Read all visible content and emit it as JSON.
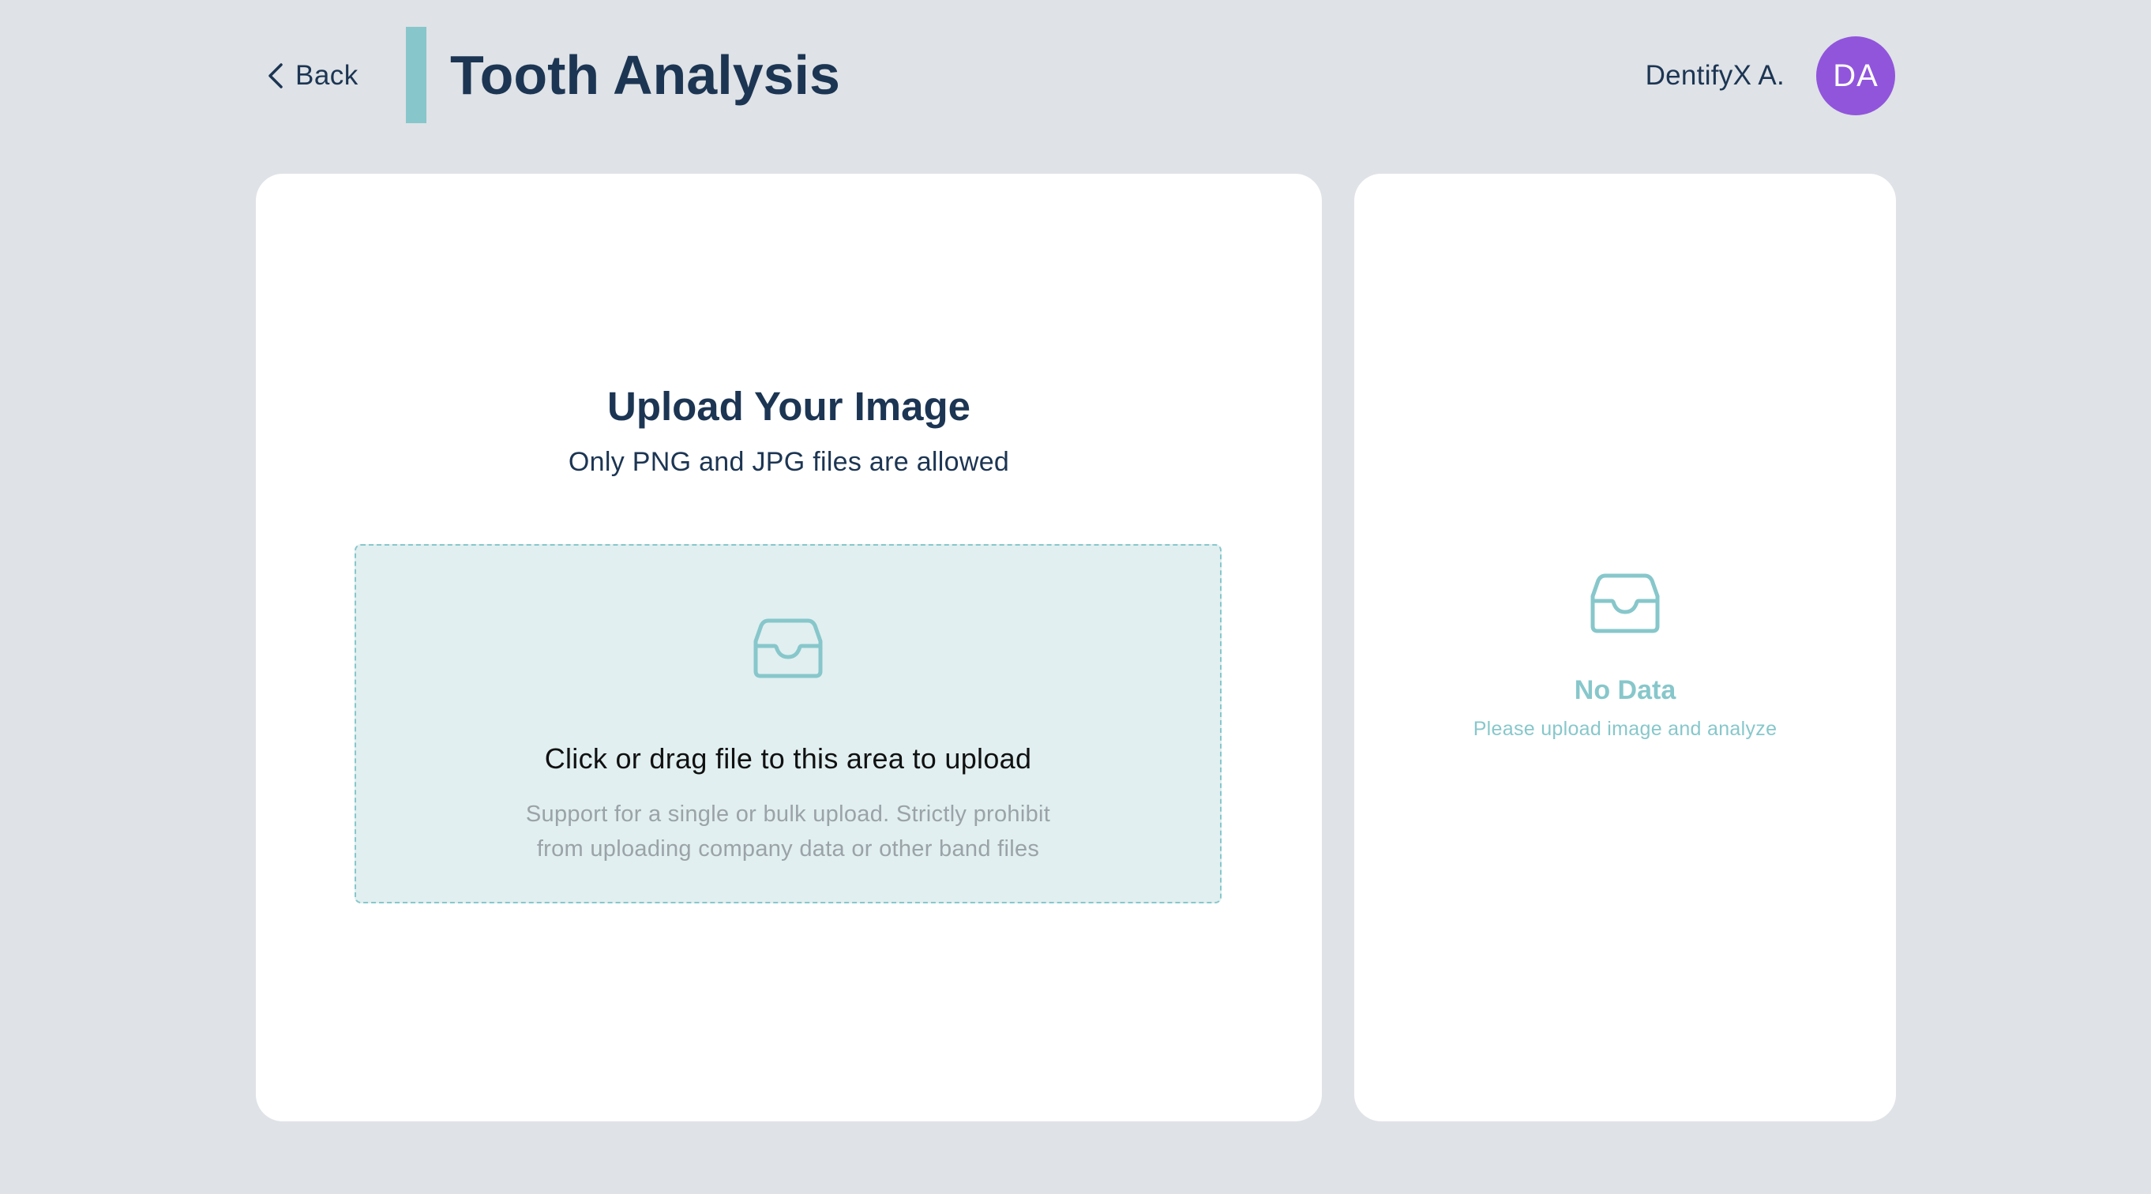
{
  "header": {
    "back_label": "Back",
    "title": "Tooth Analysis",
    "user_name": "DentifyX A.",
    "avatar_initials": "DA"
  },
  "upload": {
    "title": "Upload Your Image",
    "subtitle": "Only PNG and JPG files are allowed",
    "dropzone_icon": "inbox-icon",
    "dropzone_text": "Click or drag file to this area to upload",
    "dropzone_hint_line1": "Support for a single or bulk upload. Strictly prohibit",
    "dropzone_hint_line2": "from uploading company data or other band files"
  },
  "results": {
    "empty_icon": "inbox-icon",
    "empty_title": "No Data",
    "empty_subtitle": "Please upload image and analyze"
  },
  "colors": {
    "background": "#dfe2e6",
    "primary_text": "#1c3553",
    "accent": "#87c7cb",
    "dropzone_bg": "#e1eff0",
    "avatar": "#9155dc",
    "card": "#ffffff"
  }
}
